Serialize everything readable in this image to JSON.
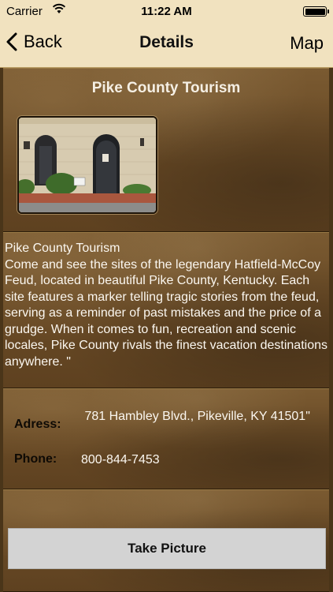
{
  "status_bar": {
    "carrier": "Carrier",
    "time": "11:22 AM",
    "battery_level": 1.0
  },
  "nav": {
    "back_label": "Back",
    "title": "Details",
    "map_label": "Map"
  },
  "place": {
    "title": "Pike County Tourism",
    "description": "Pike County Tourism\nCome and see the sites of the legendary Hatfield-McCoy Feud, located in beautiful Pike County, Kentucky. Each site features a marker telling tragic stories from the feud, serving as a reminder of past mistakes and the price of a grudge. When it comes to fun, recreation and scenic locales, Pike County rivals the finest vacation destinations anywhere. \""
  },
  "contact": {
    "address_label": "Adress:",
    "address_value": " 781 Hambley Blvd., Pikeville, KY 41501\"",
    "phone_label": "Phone:",
    "phone_value": "800-844-7453"
  },
  "actions": {
    "take_picture_label": "Take Picture"
  },
  "icons": {
    "wifi": "wifi-icon",
    "battery": "battery-icon",
    "back": "chevron-left-icon"
  },
  "colors": {
    "bar_background": "#f1e2bf",
    "panel_brown": "#6a4b26",
    "button_gray": "#d3d3d3"
  }
}
